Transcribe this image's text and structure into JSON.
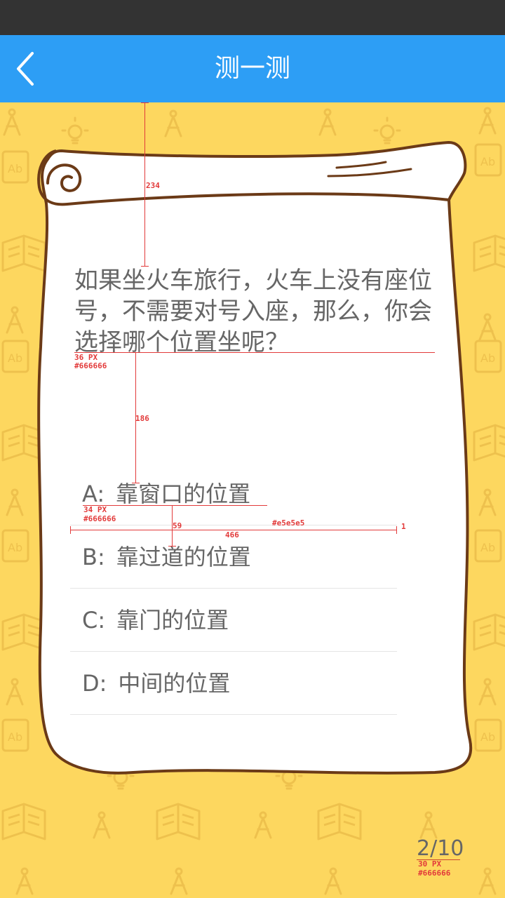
{
  "nav": {
    "title": "测一测",
    "back_icon": "chevron-left-icon"
  },
  "question": {
    "text": "如果坐火车旅行，火车上没有座位号，不需要对号入座，那么，你会选择哪个位置坐呢？"
  },
  "options": [
    {
      "letter": "A:",
      "text": "靠窗口的位置"
    },
    {
      "letter": "B:",
      "text": "靠过道的位置"
    },
    {
      "letter": "C:",
      "text": "靠门的位置"
    },
    {
      "letter": "D:",
      "text": "中间的位置"
    }
  ],
  "progress": {
    "current": "2",
    "sep": "/",
    "total": "10"
  },
  "annotations": {
    "gap_top": "234",
    "q_font": "36 PX",
    "q_color": "#666666",
    "gap_mid": "186",
    "a_font": "34 PX",
    "a_color": "#666666",
    "row_h": "59",
    "row_w": "466",
    "divider_color": "#e5e5e5",
    "divider_w": "1",
    "p_font": "30 PX",
    "p_color": "#666666"
  },
  "colors": {
    "status_bar": "#333333",
    "nav_bar": "#2d9ef5",
    "background": "#fdd75f",
    "text": "#666666",
    "divider": "#e5e5e5",
    "scroll_outline": "#6b3a17",
    "annotation": "#e23a3a"
  }
}
